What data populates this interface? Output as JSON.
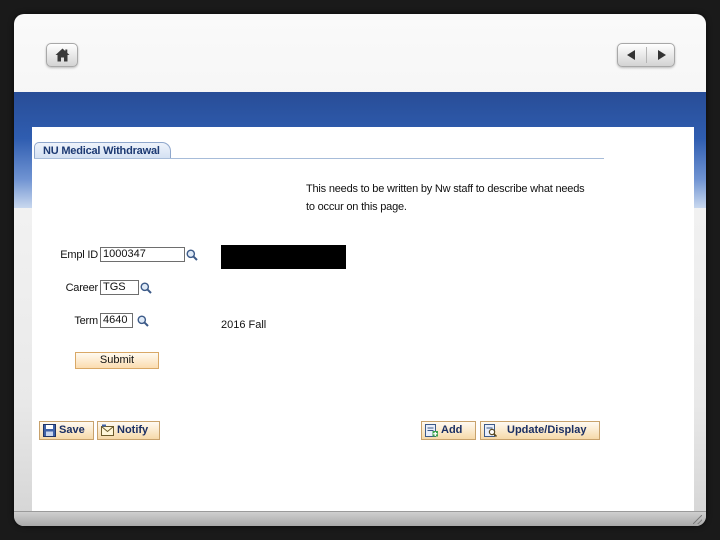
{
  "tab": {
    "label": "NU Medical Withdrawal"
  },
  "description": {
    "line1": "This needs to be written by Nw staff to describe what needs",
    "line2": "to occur on this page."
  },
  "fields": {
    "emplid": {
      "label": "Empl ID",
      "value": "1000347"
    },
    "career": {
      "label": "Career",
      "value": "TGS"
    },
    "term": {
      "label": "Term",
      "value": "4640",
      "description": "2016 Fall"
    }
  },
  "buttons": {
    "submit": "Submit",
    "save": "Save",
    "notify": "Notify",
    "add": "Add",
    "update_display": "Update/Display"
  },
  "icons": {
    "home": "home-icon",
    "prev": "arrow-left-icon",
    "next": "arrow-right-icon",
    "lookup": "magnifier-icon",
    "save": "save-disk-icon",
    "notify": "notify-icon",
    "add": "add-icon",
    "update": "update-display-icon"
  },
  "colors": {
    "banner_blue": "#2f5db0",
    "tab_text": "#1d3a73",
    "button_bg": "#f6d9a9"
  }
}
